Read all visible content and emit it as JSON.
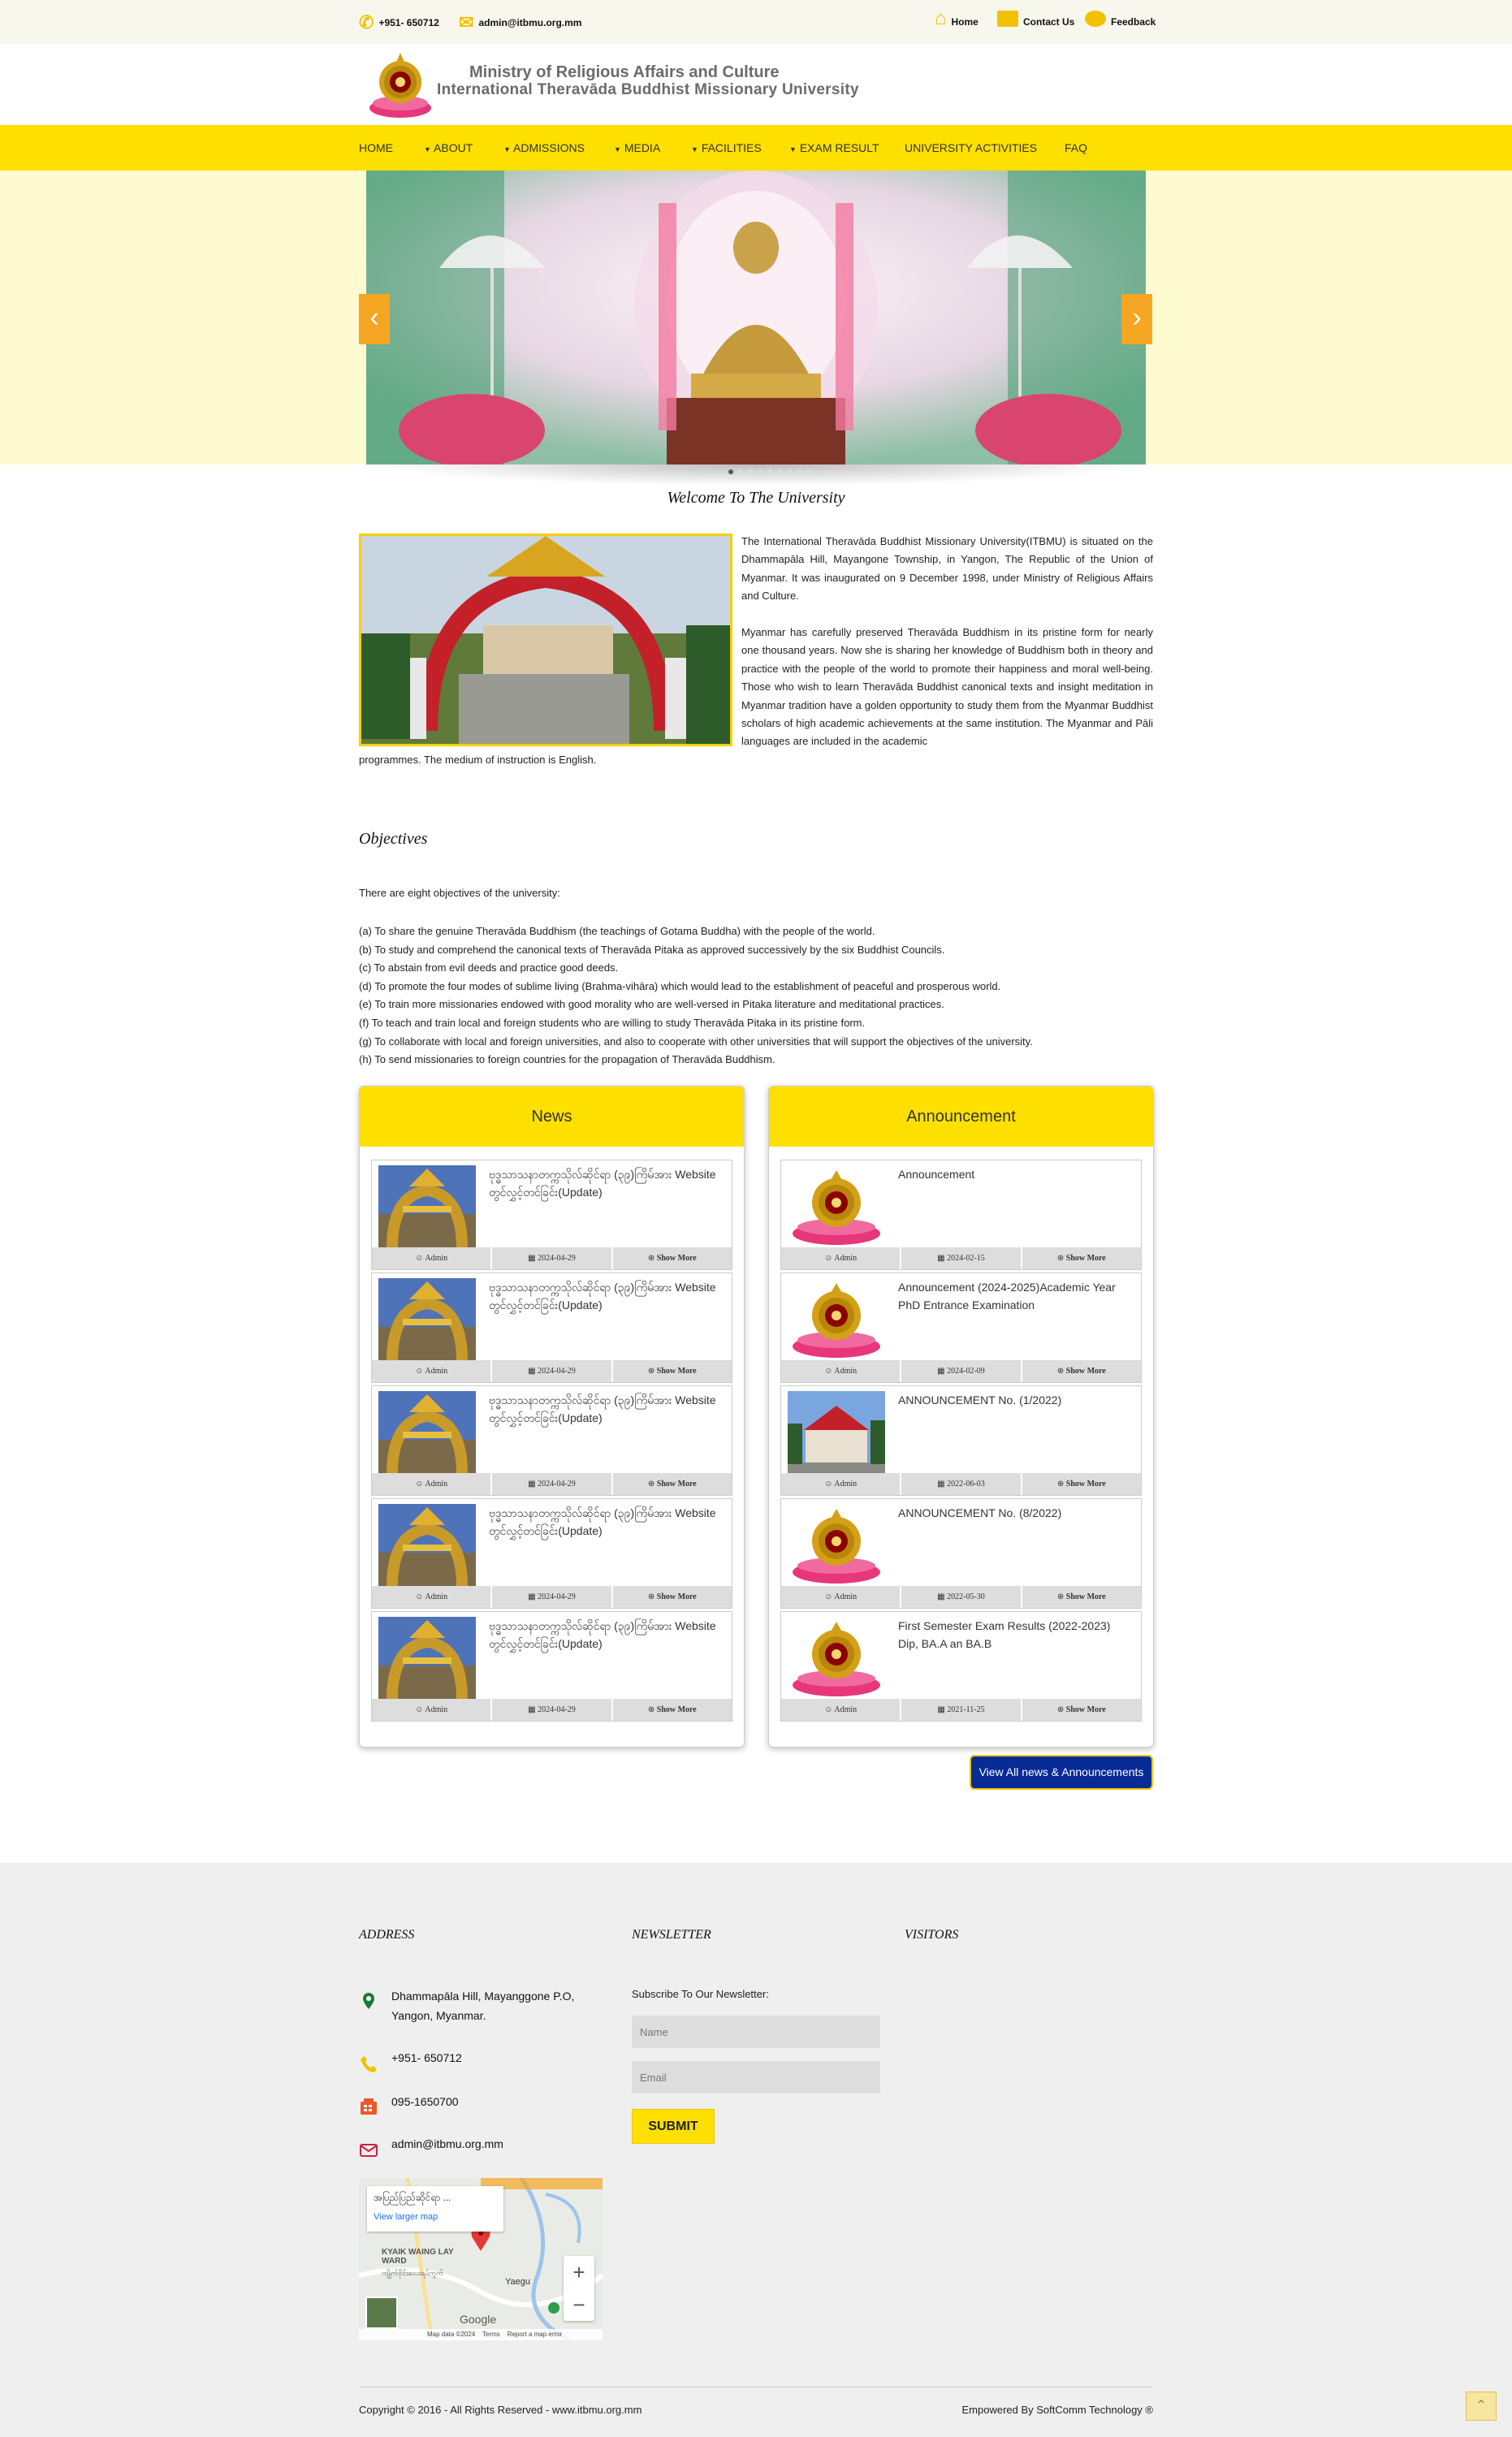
{
  "topbar": {
    "phone": "+951- 650712",
    "email": "admin@itbmu.org.mm",
    "home": "Home",
    "contact": "Contact Us",
    "feedback": "Feedback"
  },
  "header": {
    "line1": "Ministry of Religious Affairs and Culture",
    "line2": "International Theravāda Buddhist Missionary University"
  },
  "nav": {
    "items": [
      "HOME",
      "ABOUT",
      "ADMISSIONS",
      "MEDIA",
      "FACILITIES",
      "EXAM RESULT",
      "UNIVERSITY ACTIVITIES",
      "FAQ"
    ],
    "active": "HOME"
  },
  "slider": {
    "prev": "‹",
    "next": "›",
    "dots": 9,
    "active_dot": 1
  },
  "intro": {
    "welcome": "Welcome To The University",
    "p1": "The International Theravāda Buddhist Missionary University(ITBMU) is situated on the Dhammapāla Hill, Mayangone Township, in Yangon, The Republic of the Union of Myanmar. It was inaugurated on 9 December 1998, under Ministry of Religious Affairs and Culture.",
    "p2a": "Myanmar has carefully preserved Theravāda Buddhism in its pristine form for nearly one thousand years. Now she is sharing her knowledge of Buddhism both in theory and practice with the people of the world to promote their happiness and moral well-being. Those who wish to learn Theravāda Buddhist canonical texts and insight meditation in Myanmar tradition have a golden opportunity to study them from the Myanmar Buddhist scholars of high academic achievements at the same institution. The Myanmar and Pāli languages are included in the academic",
    "p2b": "programmes. The medium of instruction is English."
  },
  "objectives": {
    "title": "Objectives",
    "intro": "There are eight objectives of the university:",
    "items": [
      "(a) To share the genuine Theravāda Buddhism (the teachings of Gotama Buddha) with the people of the world.",
      "(b) To study and comprehend the canonical texts of Theravāda Pitaka as approved successively by the six Buddhist Councils.",
      "(c) To abstain from evil deeds and practice good deeds.",
      "(d) To promote the four modes of sublime living (Brahma-vihāra) which would lead to the establishment of peaceful and prosperous world.",
      "(e) To train more missionaries endowed with good morality who are well-versed in Pitaka literature and meditational practices.",
      "(f) To teach and train local and foreign students who are willing to study Theravāda Pitaka in its pristine form.",
      "(g) To collaborate with local and foreign universities, and also to cooperate with other universities that will support the objectives of the university.",
      "(h) To send missionaries to foreign countries for the propagation of Theravāda Buddhism."
    ]
  },
  "news": {
    "title": "News",
    "items": [
      {
        "title": "ဗုဒ္ဓသာသနာတက္ကသိုလ်ဆိုင်ရာ (၃၉)ကြိမ်အား Website တွင်လွှင့်တင်ခြင်း(Update)",
        "author": "Admin",
        "date": "2024-04-29",
        "more": "Show More"
      },
      {
        "title": "ဗုဒ္ဓသာသနာတက္ကသိုလ်ဆိုင်ရာ (၃၉)ကြိမ်အား Website တွင်လွှင့်တင်ခြင်း(Update)",
        "author": "Admin",
        "date": "2024-04-29",
        "more": "Show More"
      },
      {
        "title": "ဗုဒ္ဓသာသနာတက္ကသိုလ်ဆိုင်ရာ (၃၉)ကြိမ်အား Website တွင်လွှင့်တင်ခြင်း(Update)",
        "author": "Admin",
        "date": "2024-04-29",
        "more": "Show More"
      },
      {
        "title": "ဗုဒ္ဓသာသနာတက္ကသိုလ်ဆိုင်ရာ (၃၉)ကြိမ်အား Website တွင်လွှင့်တင်ခြင်း(Update)",
        "author": "Admin",
        "date": "2024-04-29",
        "more": "Show More"
      },
      {
        "title": "ဗုဒ္ဓသာသနာတက္ကသိုလ်ဆိုင်ရာ (၃၉)ကြိမ်အား Website တွင်လွှင့်တင်ခြင်း(Update)",
        "author": "Admin",
        "date": "2024-04-29",
        "more": "Show More"
      }
    ]
  },
  "announcements": {
    "title": "Announcement",
    "items": [
      {
        "title": "Announcement",
        "author": "Admin",
        "date": "2024-02-15",
        "more": "Show More",
        "thumb": "emblem"
      },
      {
        "title": "Announcement (2024-2025)Academic Year PhD Entrance Examination",
        "author": "Admin",
        "date": "2024-02-09",
        "more": "Show More",
        "thumb": "emblem"
      },
      {
        "title": "ANNOUNCEMENT No. (1/2022)",
        "author": "Admin",
        "date": "2022-06-03",
        "more": "Show More",
        "thumb": "building"
      },
      {
        "title": "ANNOUNCEMENT No. (8/2022)",
        "author": "Admin",
        "date": "2022-05-30",
        "more": "Show More",
        "thumb": "emblem"
      },
      {
        "title": "First Semester Exam Results (2022-2023) Dip, BA.A an BA.B",
        "author": "Admin",
        "date": "2021-11-25",
        "more": "Show More",
        "thumb": "emblem"
      }
    ]
  },
  "view_all": "View All news & Announcements",
  "footer": {
    "address_title": "ADDRESS",
    "newsletter_title": "NEWSLETTER",
    "visitors_title": "VISITORS",
    "address": "Dhammapāla Hill, Mayanggone P.O, Yangon, Myanmar.",
    "phone": "+951- 650712",
    "fax": "095-1650700",
    "email": "admin@itbmu.org.mm",
    "newsletter_label": "Subscribe To Our Newsletter:",
    "name_placeholder": "Name",
    "email_placeholder": "Email",
    "submit": "SUBMIT",
    "map": {
      "place": "အပြည်ပြည်ဆိုင်ရာ ...",
      "larger": "View larger map",
      "ward": "KYAIK WAING LAY WARD",
      "ward_my": "ကျိုက်ဝိုင်းလေးရပ်ကွက်",
      "yaegu": "Yaegu",
      "credit": "Map data ©2024",
      "terms": "Terms",
      "report": "Report a map error",
      "google": "Google"
    },
    "copyright": "Copyright © 2016 - All Rights Reserved - www.itbmu.org.mm",
    "powered": "Empowered By SoftComm Technology ®"
  },
  "colors": {
    "brand_yellow": "#fde000",
    "accent_orange": "#f5a623",
    "button_blue": "#062b96"
  }
}
